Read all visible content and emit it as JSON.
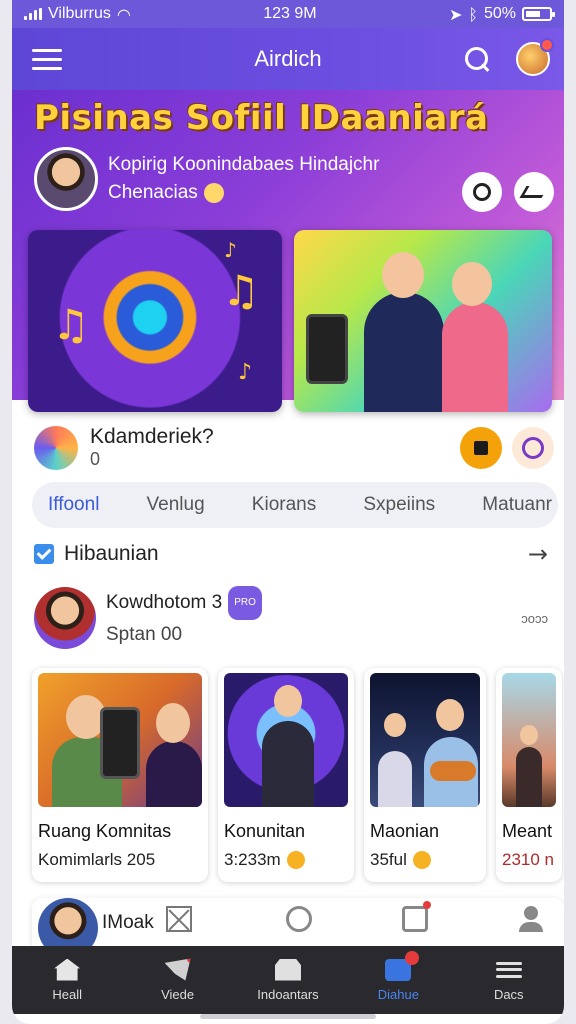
{
  "status_bar": {
    "carrier": "Vilburrus",
    "time": "123 9M",
    "battery": "50%"
  },
  "app_bar": {
    "title": "Airdich"
  },
  "hero": {
    "title": "Pisinas Sofiil IDaaniará",
    "user_line1": "Kopirig Koonindabaes Hindajchr",
    "user_line2": "Chenacias"
  },
  "prompt": {
    "text": "Kdamderiek?",
    "count": "0"
  },
  "tabs": [
    {
      "label": "Iffoonl",
      "active": true
    },
    {
      "label": "Venlug",
      "active": false
    },
    {
      "label": "Kiorans",
      "active": false
    },
    {
      "label": "Sxpeiins",
      "active": false
    },
    {
      "label": "Matuanr",
      "active": false
    }
  ],
  "section": {
    "title": "Hibaunian"
  },
  "featured_user": {
    "name": "Kowdhotom 3",
    "badge": "PRO",
    "subtitle": "Sptan 00",
    "right_text": "ɔoɔɔ"
  },
  "cards": [
    {
      "name": "Ruang Komnitas",
      "meta": "Komimlarls 205"
    },
    {
      "name": "Konunitan",
      "meta": "3:233m"
    },
    {
      "name": "Maonian",
      "meta": "35ful"
    },
    {
      "name": "Meant",
      "meta": "2310 n"
    }
  ],
  "peek_row": {
    "name": "IMoak"
  },
  "bottom_nav": [
    {
      "label": "Heall",
      "icon": "home-icon"
    },
    {
      "label": "Viede",
      "icon": "video-icon"
    },
    {
      "label": "Indoantars",
      "icon": "store-icon"
    },
    {
      "label": "Diahue",
      "icon": "calendar-icon",
      "active": true
    },
    {
      "label": "Dacs",
      "icon": "menu-icon"
    }
  ],
  "colors": {
    "primary": "#6b4fe0",
    "accent_yellow": "#ffd23d",
    "active_tab": "#3b5bd8",
    "nav_bg": "#2a2a2e",
    "nav_active": "#4a84f0"
  }
}
